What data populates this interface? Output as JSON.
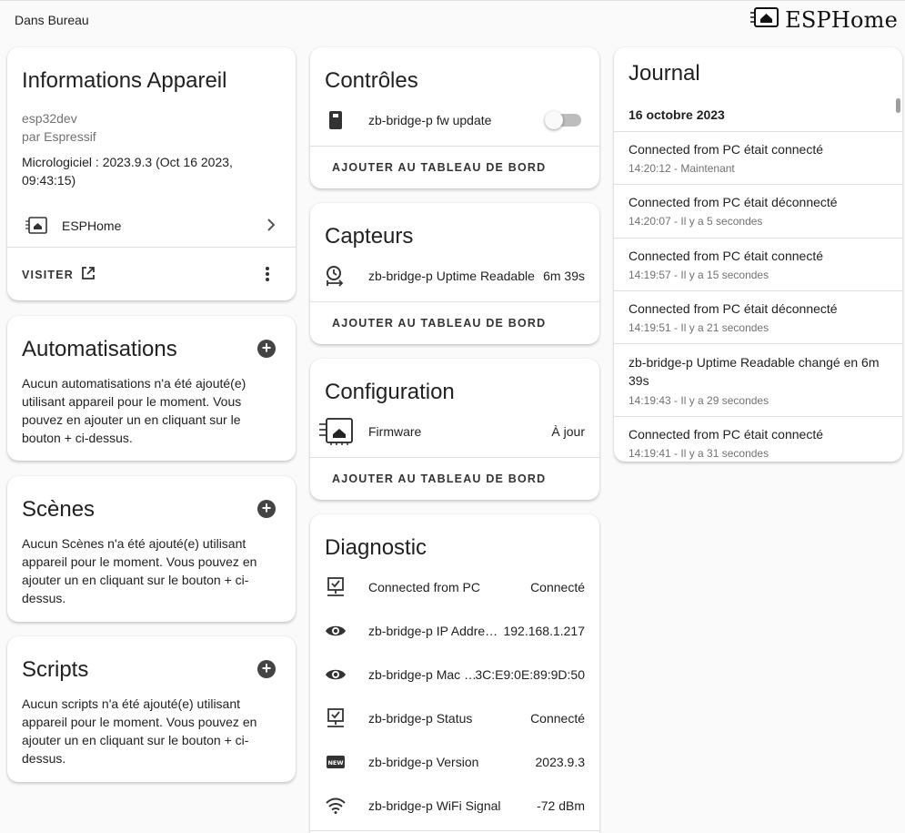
{
  "header": {
    "area": "Dans Bureau",
    "brand": "ESPHome"
  },
  "device_info": {
    "title": "Informations Appareil",
    "model": "esp32dev",
    "manufacturer": "par Espressif",
    "firmware": "Micrologiciel : 2023.9.3 (Oct 16 2023, 09:43:15)",
    "integration": "ESPHome",
    "visit_label": "VISITER"
  },
  "automations": {
    "title": "Automatisations",
    "text": "Aucun automatisations n'a été ajouté(e) utilisant appareil pour le moment. Vous pouvez en ajouter un en cliquant sur le bouton + ci-dessus."
  },
  "scenes": {
    "title": "Scènes",
    "text": "Aucun Scènes n'a été ajouté(e) utilisant appareil pour le moment. Vous pouvez en ajouter un en cliquant sur le bouton + ci-dessus."
  },
  "scripts": {
    "title": "Scripts",
    "text": "Aucun scripts n'a été ajouté(e) utilisant appareil pour le moment. Vous pouvez en ajouter un en cliquant sur le bouton + ci-dessus."
  },
  "controls": {
    "title": "Contrôles",
    "rows": [
      {
        "icon": "memory-card-icon",
        "label": "zb-bridge-p fw update",
        "state": "off"
      }
    ],
    "add_label": "AJOUTER AU TABLEAU DE BORD"
  },
  "sensors": {
    "title": "Capteurs",
    "rows": [
      {
        "icon": "timer-icon",
        "label": "zb-bridge-p Uptime Readable",
        "value": "6m 39s"
      }
    ],
    "add_label": "AJOUTER AU TABLEAU DE BORD"
  },
  "configuration": {
    "title": "Configuration",
    "rows": [
      {
        "icon": "esphome-chip-icon",
        "label": "Firmware",
        "value": "À jour"
      }
    ],
    "add_label": "AJOUTER AU TABLEAU DE BORD"
  },
  "diagnostic": {
    "title": "Diagnostic",
    "rows": [
      {
        "icon": "monitor-check-icon",
        "label": "Connected from PC",
        "value": "Connecté"
      },
      {
        "icon": "eye-icon",
        "label": "zb-bridge-p IP Addre…",
        "value": "192.168.1.217"
      },
      {
        "icon": "eye-icon",
        "label": "zb-bridge-p Mac …",
        "value": "3C:E9:0E:89:9D:50"
      },
      {
        "icon": "monitor-check-icon",
        "label": "zb-bridge-p Status",
        "value": "Connecté"
      },
      {
        "icon": "new-box-icon",
        "label": "zb-bridge-p Version",
        "value": "2023.9.3"
      },
      {
        "icon": "wifi-icon",
        "label": "zb-bridge-p WiFi Signal",
        "value": "-72 dBm"
      }
    ]
  },
  "journal": {
    "title": "Journal",
    "date": "16 octobre 2023",
    "entries": [
      {
        "message": "Connected from PC était connecté",
        "time": "14:20:12 - Maintenant"
      },
      {
        "message": "Connected from PC était déconnecté",
        "time": "14:20:07 - Il y a 5 secondes"
      },
      {
        "message": "Connected from PC était connecté",
        "time": "14:19:57 - Il y a 15 secondes"
      },
      {
        "message": "Connected from PC était déconnecté",
        "time": "14:19:51 - Il y a 21 secondes"
      },
      {
        "message": "zb-bridge-p Uptime Readable changé en 6m 39s",
        "time": "14:19:43 - Il y a 29 secondes"
      },
      {
        "message": "Connected from PC était connecté",
        "time": "14:19:41 - Il y a 31 secondes"
      }
    ]
  }
}
